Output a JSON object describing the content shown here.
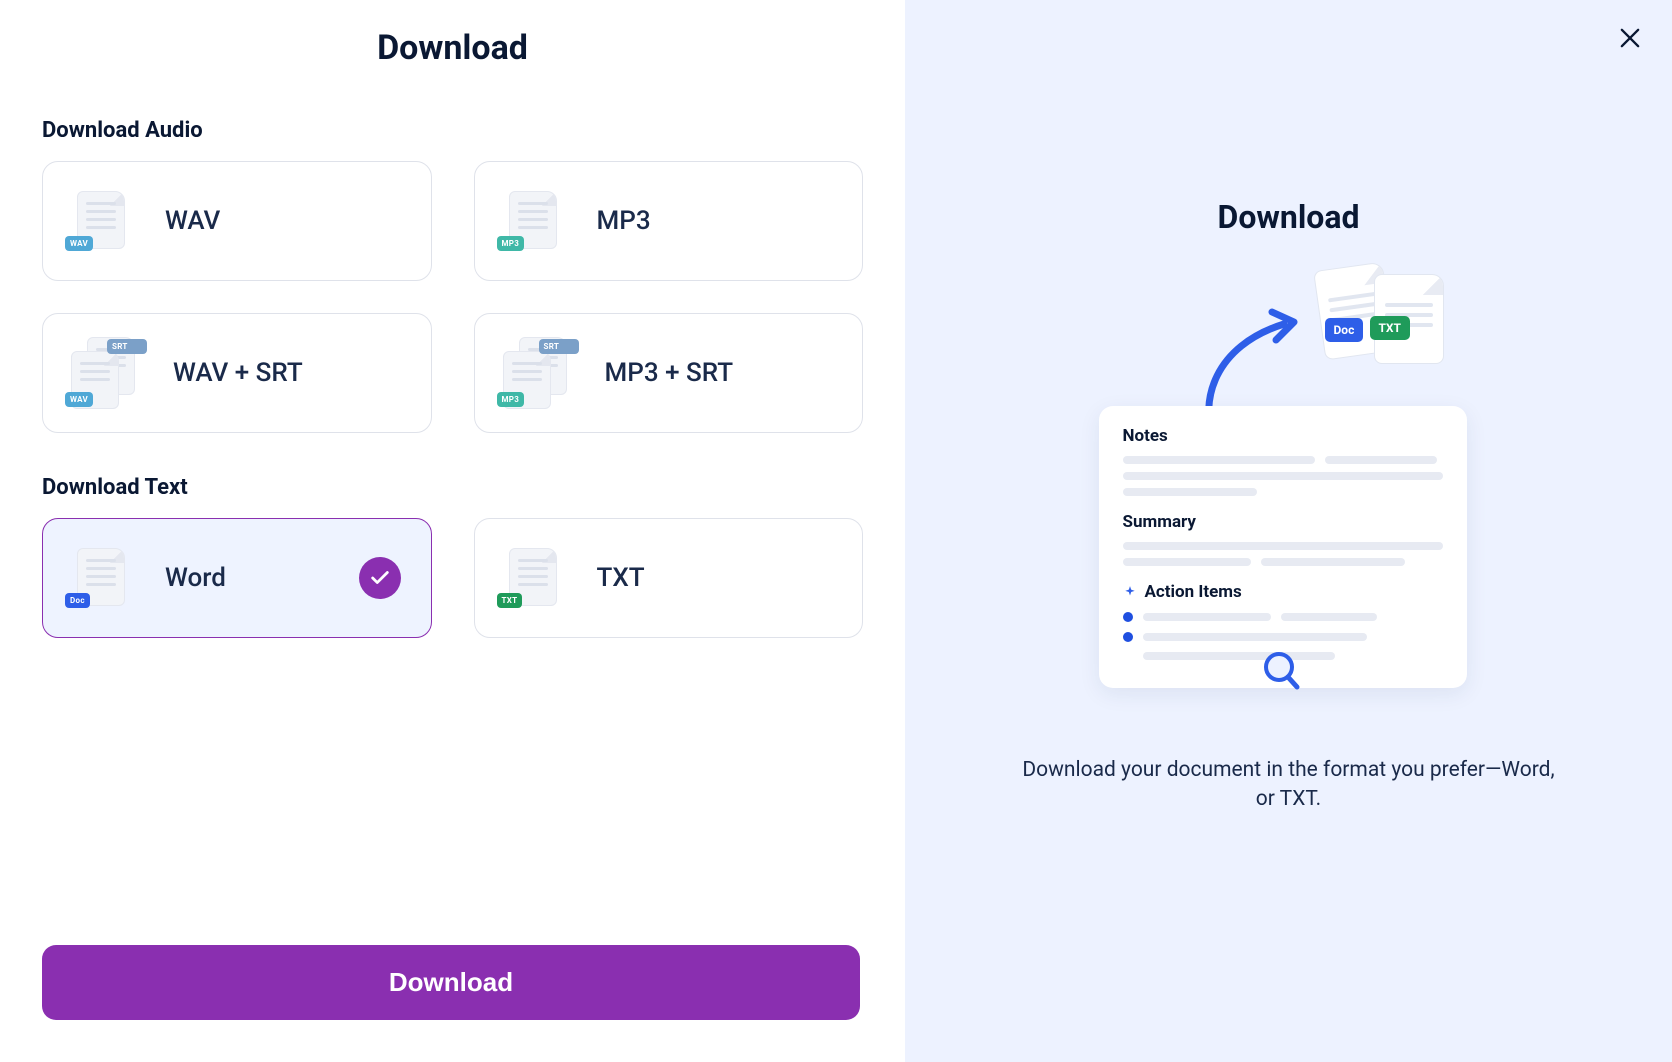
{
  "page_title": "Download",
  "audio_section": {
    "title": "Download Audio",
    "options": [
      {
        "label": "WAV",
        "tags": [
          "WAV"
        ]
      },
      {
        "label": "MP3",
        "tags": [
          "MP3"
        ]
      },
      {
        "label": "WAV + SRT",
        "tags": [
          "WAV",
          "SRT"
        ]
      },
      {
        "label": "MP3 + SRT",
        "tags": [
          "MP3",
          "SRT"
        ]
      }
    ]
  },
  "text_section": {
    "title": "Download Text",
    "options": [
      {
        "label": "Word",
        "tag": "Doc",
        "selected": true
      },
      {
        "label": "TXT",
        "tag": "TXT",
        "selected": false
      }
    ]
  },
  "download_button": "Download",
  "info": {
    "title": "Download",
    "description": "Download your document in the format you prefer—Word, or TXT.",
    "card": {
      "notes_label": "Notes",
      "summary_label": "Summary",
      "action_items_label": "Action Items"
    },
    "file_tags": {
      "doc": "Doc",
      "txt": "TXT"
    }
  }
}
